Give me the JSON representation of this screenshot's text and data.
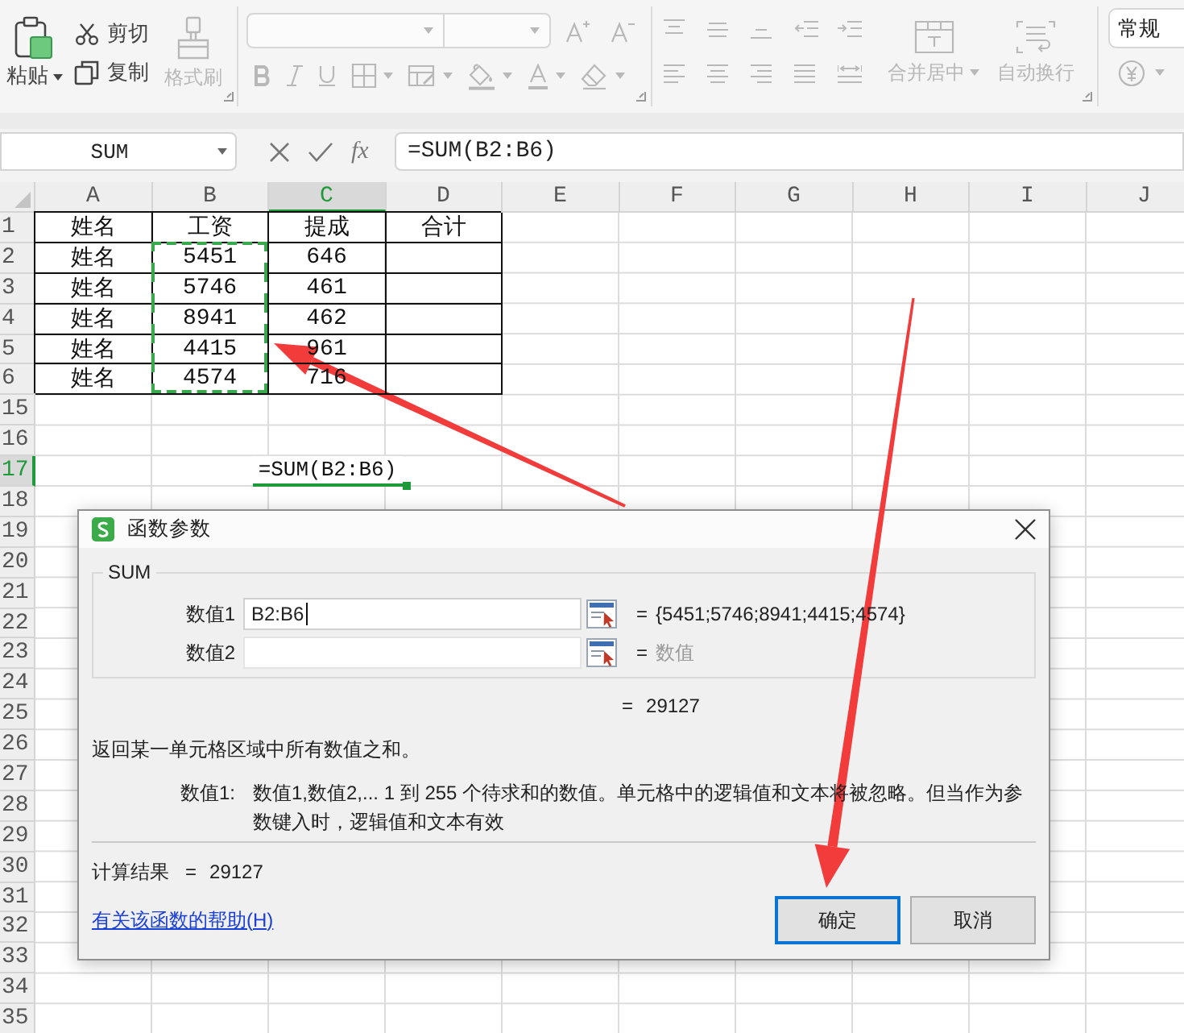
{
  "ribbon": {
    "paste": {
      "label": "粘贴",
      "disabled": false
    },
    "cut": {
      "label": "剪切",
      "disabled": false
    },
    "copy": {
      "label": "复制",
      "disabled": false
    },
    "format_painter": {
      "label": "格式刷",
      "disabled": true
    },
    "font_group": {
      "disabled": true
    },
    "alignment_group": {
      "disabled": true
    },
    "merge_center": {
      "label": "合并居中",
      "disabled": true
    },
    "wrap_text": {
      "label": "自动换行",
      "disabled": true
    },
    "number_format": {
      "value": "常规"
    },
    "currency": {
      "disabled": true
    }
  },
  "formula_bar": {
    "name_box": "SUM",
    "function_label": "fx",
    "formula": "=SUM(B2:B6)"
  },
  "sheet": {
    "columns": [
      {
        "label": "A",
        "selected": false
      },
      {
        "label": "B",
        "selected": false
      },
      {
        "label": "C",
        "selected": true
      },
      {
        "label": "D",
        "selected": false
      },
      {
        "label": "E",
        "selected": false
      },
      {
        "label": "F",
        "selected": false
      },
      {
        "label": "G",
        "selected": false
      },
      {
        "label": "H",
        "selected": false
      },
      {
        "label": "I",
        "selected": false
      },
      {
        "label": "J",
        "selected": false
      }
    ],
    "rows": [
      {
        "label": "1",
        "selected": false,
        "cells": [
          {
            "text": "姓名",
            "bordered": true,
            "marked": false
          },
          {
            "text": "工资",
            "bordered": true,
            "marked": false
          },
          {
            "text": "提成",
            "bordered": true,
            "marked": false
          },
          {
            "text": "合计",
            "bordered": true,
            "marked": false
          }
        ]
      },
      {
        "label": "2",
        "selected": false,
        "cells": [
          {
            "text": "姓名",
            "bordered": true,
            "marked": false
          },
          {
            "text": "5451",
            "bordered": true,
            "marked": true
          },
          {
            "text": "646",
            "bordered": true,
            "marked": false
          },
          {
            "bordered": true,
            "marked": false
          }
        ]
      },
      {
        "label": "3",
        "selected": false,
        "cells": [
          {
            "text": "姓名",
            "bordered": true,
            "marked": false
          },
          {
            "text": "5746",
            "bordered": true,
            "marked": true
          },
          {
            "text": "461",
            "bordered": true,
            "marked": false
          },
          {
            "bordered": true,
            "marked": false
          }
        ]
      },
      {
        "label": "4",
        "selected": false,
        "cells": [
          {
            "text": "姓名",
            "bordered": true,
            "marked": false
          },
          {
            "text": "8941",
            "bordered": true,
            "marked": true
          },
          {
            "text": "462",
            "bordered": true,
            "marked": false
          },
          {
            "bordered": true,
            "marked": false
          }
        ]
      },
      {
        "label": "5",
        "selected": false,
        "cells": [
          {
            "text": "姓名",
            "bordered": true,
            "marked": false
          },
          {
            "text": "4415",
            "bordered": true,
            "marked": true
          },
          {
            "text": "961",
            "bordered": true,
            "marked": false
          },
          {
            "bordered": true,
            "marked": false
          }
        ]
      },
      {
        "label": "6",
        "selected": false,
        "cells": [
          {
            "text": "姓名",
            "bordered": true,
            "marked": false
          },
          {
            "text": "4574",
            "bordered": true,
            "marked": true
          },
          {
            "text": "716",
            "bordered": true,
            "marked": false
          },
          {
            "bordered": true,
            "marked": false
          }
        ]
      },
      {
        "label": "15",
        "selected": false
      },
      {
        "label": "16",
        "selected": false
      },
      {
        "label": "17",
        "selected": true,
        "edit_text": "=SUM(B2:B6)"
      },
      {
        "label": "18",
        "selected": false
      },
      {
        "label": "19",
        "selected": false
      },
      {
        "label": "20",
        "selected": false
      },
      {
        "label": "21",
        "selected": false
      },
      {
        "label": "22",
        "selected": false
      },
      {
        "label": "23",
        "selected": false
      },
      {
        "label": "24",
        "selected": false
      },
      {
        "label": "25",
        "selected": false
      },
      {
        "label": "26",
        "selected": false
      },
      {
        "label": "27",
        "selected": false
      },
      {
        "label": "28",
        "selected": false
      },
      {
        "label": "29",
        "selected": false
      },
      {
        "label": "30",
        "selected": false
      },
      {
        "label": "31",
        "selected": false
      },
      {
        "label": "32",
        "selected": false
      },
      {
        "label": "33",
        "selected": false
      },
      {
        "label": "34",
        "selected": false
      },
      {
        "label": "35",
        "selected": false
      }
    ]
  },
  "dialog": {
    "title": "函数参数",
    "function_name": "SUM",
    "arguments": [
      {
        "label": "数值1",
        "value": "B2:B6",
        "focused": true,
        "equals": "=",
        "result": "{5451;5746;8941;4415;4574}"
      },
      {
        "label": "数值2",
        "focused": false,
        "equals": "=",
        "hint": "数值"
      }
    ],
    "total": {
      "equals": "=",
      "value": "29127"
    },
    "description": "返回某一单元格区域中所有数值之和。",
    "argument_help": {
      "label": "数值1:",
      "text": "数值1,数值2,... 1 到 255 个待求和的数值。单元格中的逻辑值和文本将被忽略。但当作为参数键入时，逻辑值和文本有效"
    },
    "result": {
      "label": "计算结果",
      "equals": "=",
      "value": "29127"
    },
    "help_link": "有关该函数的帮助(H)",
    "buttons": [
      {
        "label": "确定",
        "selected": true
      },
      {
        "label": "取消",
        "selected": false
      }
    ]
  }
}
